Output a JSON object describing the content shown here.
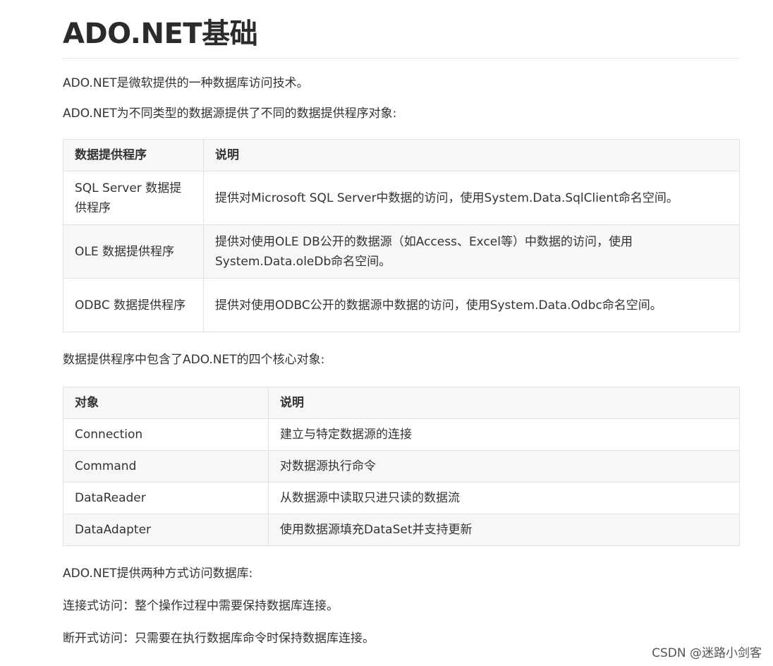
{
  "title": "ADO.NET基础",
  "intro": [
    "ADO.NET是微软提供的一种数据库访问技术。",
    "ADO.NET为不同类型的数据源提供了不同的数据提供程序对象:"
  ],
  "providers_table": {
    "headers": [
      "数据提供程序",
      "说明"
    ],
    "rows": [
      [
        "SQL Server 数据提供程序",
        "提供对Microsoft SQL Server中数据的访问，使用System.Data.SqlClient命名空间。"
      ],
      [
        "OLE 数据提供程序",
        "提供对使用OLE DB公开的数据源（如Access、Excel等）中数据的访问，使用System.Data.oleDb命名空间。"
      ],
      [
        "ODBC 数据提供程序",
        "提供对使用ODBC公开的数据源中数据的访问，使用System.Data.Odbc命名空间。"
      ]
    ]
  },
  "core_intro": "数据提供程序中包含了ADO.NET的四个核心对象:",
  "objects_table": {
    "headers": [
      "对象",
      "说明"
    ],
    "rows": [
      [
        "Connection",
        "建立与特定数据源的连接"
      ],
      [
        "Command",
        "对数据源执行命令"
      ],
      [
        "DataReader",
        "从数据源中读取只进只读的数据流"
      ],
      [
        "DataAdapter",
        "使用数据源填充DataSet并支持更新"
      ]
    ]
  },
  "access_intro": "ADO.NET提供两种方式访问数据库:",
  "access_modes": [
    "连接式访问：整个操作过程中需要保持数据库连接。",
    "断开式访问：只需要在执行数据库命令时保持数据库连接。"
  ],
  "watermark": "CSDN @迷路小剑客"
}
